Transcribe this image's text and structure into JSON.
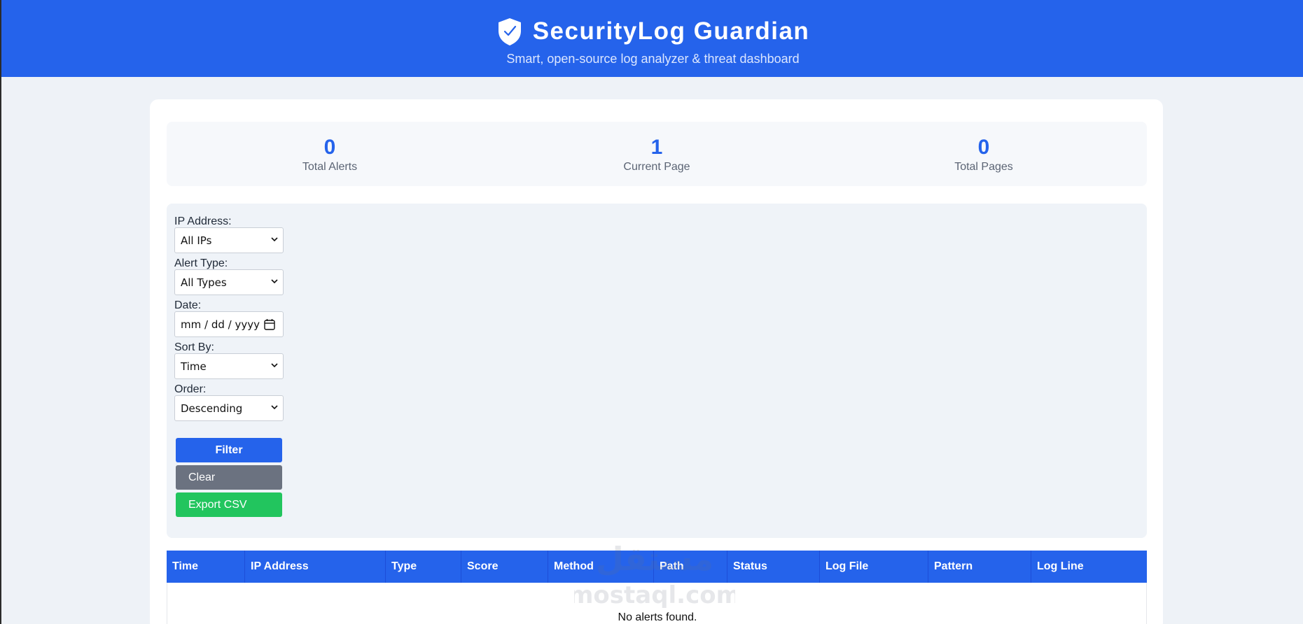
{
  "header": {
    "title": "SecurityLog Guardian",
    "subtitle": "Smart, open-source log analyzer & threat dashboard",
    "logo_icon": "shield-check-icon"
  },
  "colors": {
    "primary": "#2563eb",
    "clear": "#6b7280",
    "export": "#22c55e",
    "background": "#eef2f7"
  },
  "stats": [
    {
      "value": "0",
      "label": "Total Alerts"
    },
    {
      "value": "1",
      "label": "Current Page"
    },
    {
      "value": "0",
      "label": "Total Pages"
    }
  ],
  "filters": {
    "ip": {
      "label": "IP Address:",
      "value": "All IPs"
    },
    "type": {
      "label": "Alert Type:",
      "value": "All Types"
    },
    "date": {
      "label": "Date:",
      "value": "mm / dd / yyyy"
    },
    "sort": {
      "label": "Sort By:",
      "value": "Time"
    },
    "order": {
      "label": "Order:",
      "value": "Descending"
    }
  },
  "buttons": {
    "filter": "Filter",
    "clear": "Clear",
    "export": "Export CSV"
  },
  "table": {
    "columns": [
      "Time",
      "IP Address",
      "Type",
      "Score",
      "Method",
      "Path",
      "Status",
      "Log File",
      "Pattern",
      "Log Line"
    ],
    "empty_message": "No alerts found."
  },
  "watermark": {
    "text": "mostaql.com",
    "arabic": "مستقل"
  }
}
